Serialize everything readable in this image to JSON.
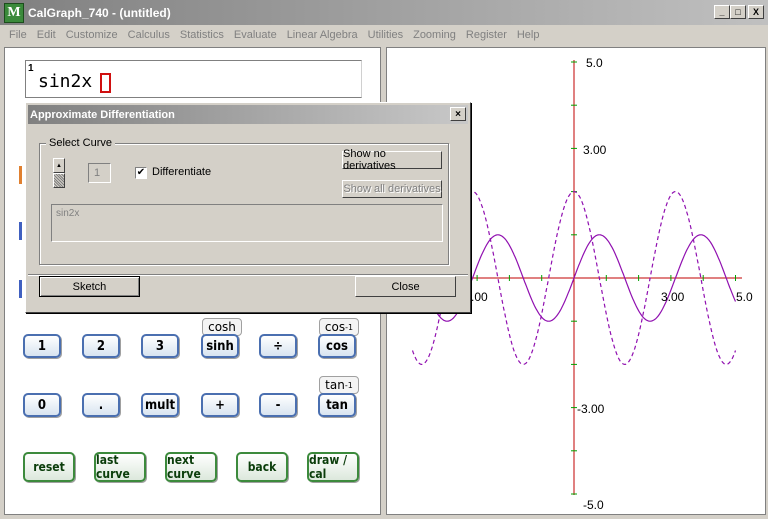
{
  "window": {
    "title": "CalGraph_740 - (untitled)",
    "icon_letter": "M",
    "min_label": "_",
    "max_label": "□",
    "close_label": "X"
  },
  "menu": [
    "File",
    "Edit",
    "Customize",
    "Calculus",
    "Statistics",
    "Evaluate",
    "Linear Algebra",
    "Utilities",
    "Zooming",
    "Register",
    "Help"
  ],
  "expression": {
    "line_number": "1",
    "text": "sin2x"
  },
  "calculator": {
    "row1": [
      "1",
      "2",
      "3",
      "sinh",
      "÷",
      "cos"
    ],
    "row2": [
      "0",
      ".",
      "mult",
      "+",
      "-",
      "tan"
    ],
    "tags": {
      "cosh": "cosh",
      "cos_inv": "cos",
      "tan_inv": "tan",
      "inv_sup": "-1"
    },
    "bottom": [
      "reset",
      "last curve",
      "next curve",
      "back",
      "draw / cal"
    ]
  },
  "graph": {
    "y_labels": [
      "5.0",
      "3.00",
      "-3.00",
      "-5.0"
    ],
    "x_labels": [
      "-3.00",
      "3.00",
      "5.0"
    ],
    "x_label_visible_left": ".00",
    "xlim": [
      -5,
      5
    ],
    "ylim": [
      -5,
      5
    ],
    "curves": [
      {
        "name": "sin2x",
        "style": "solid",
        "color": "#9010b0"
      },
      {
        "name": "derivative",
        "style": "dashed",
        "color": "#9010b0"
      }
    ],
    "axis_color": "#c00000"
  },
  "dialog": {
    "title": "Approximate Differentiation",
    "close_label": "×",
    "group_label": "Select Curve",
    "curve_number": "1",
    "differentiate_label": "Differentiate",
    "differentiate_checked": true,
    "show_no_label": "Show no derivatives",
    "show_all_label": "Show all derivatives",
    "curve_text": "sin2x",
    "sketch_label": "Sketch",
    "close_button_label": "Close"
  }
}
